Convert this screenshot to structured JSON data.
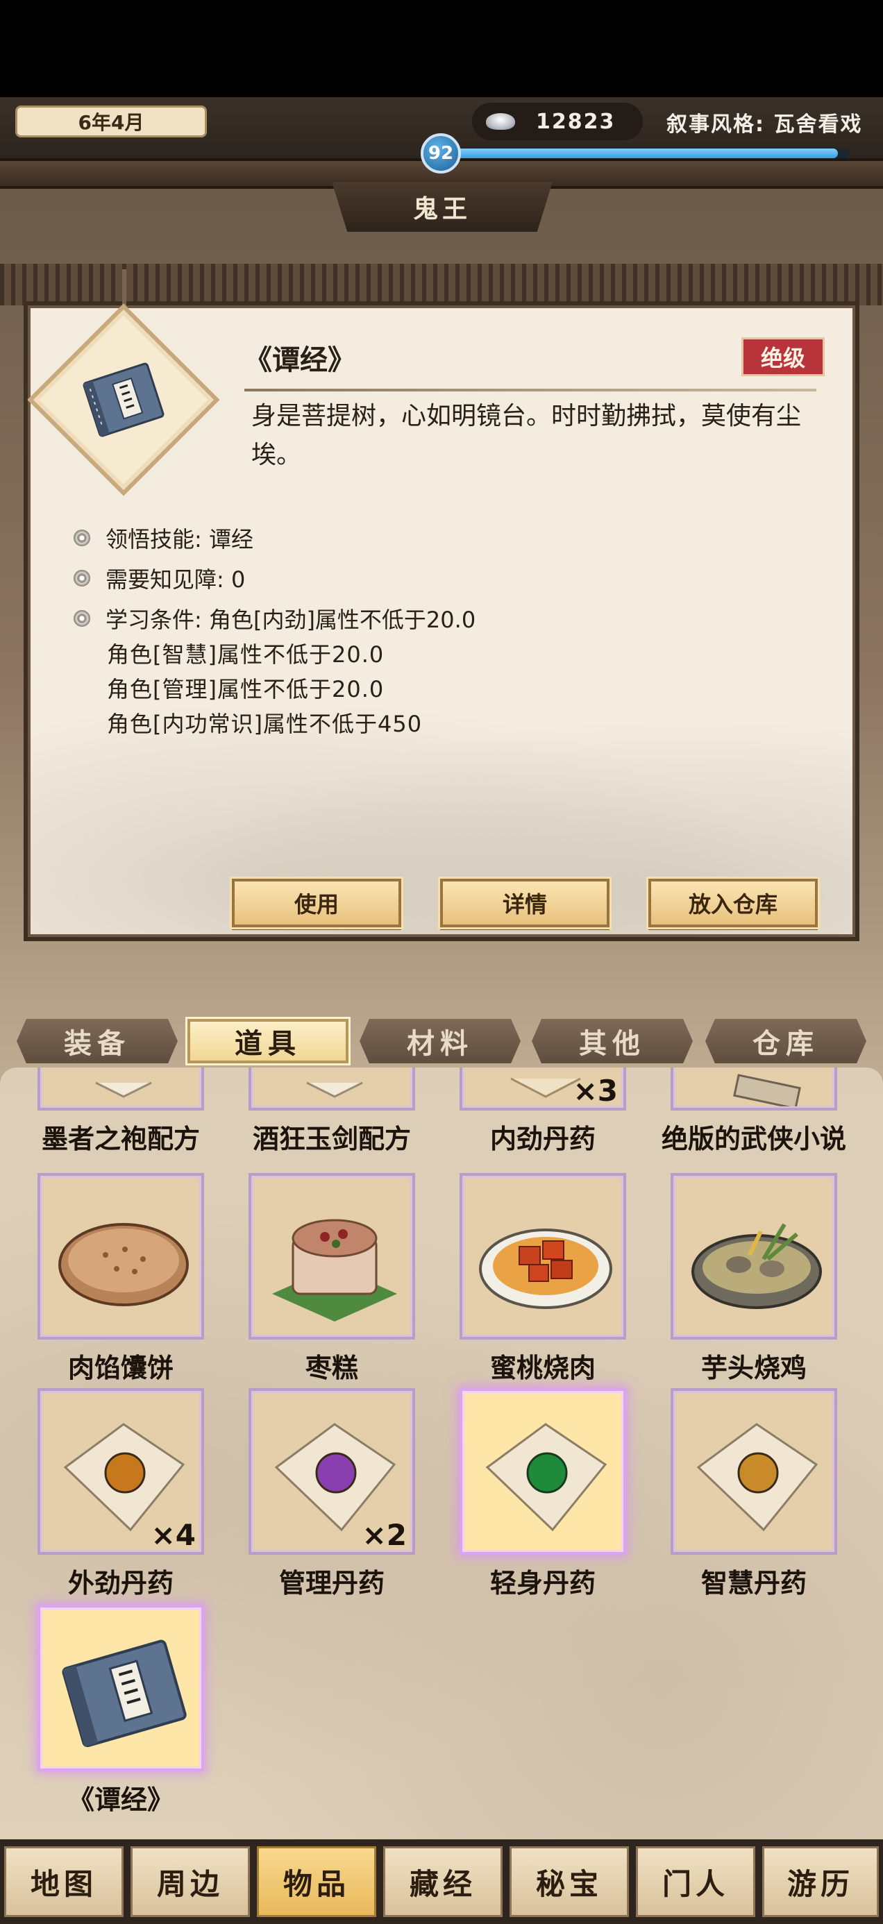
{
  "header": {
    "date": "6年4月",
    "silver": "12823",
    "style_label": "叙事风格: 瓦舍看戏",
    "level": "92",
    "xp_fraction": 0.97
  },
  "page_title": "鬼王",
  "item": {
    "name": "《谭经》",
    "grade": "绝级",
    "desc": "身是菩提树，心如明镜台。时时勤拂拭，莫使有尘埃。",
    "attrs": [
      "领悟技能: 谭经",
      "需要知见障: 0",
      "学习条件: 角色[内劲]属性不低于20.0"
    ],
    "conditions": [
      "角色[智慧]属性不低于20.0",
      "角色[管理]属性不低于20.0",
      "角色[内功常识]属性不低于450"
    ],
    "buttons": {
      "use": "使用",
      "detail": "详情",
      "store": "放入仓库"
    }
  },
  "tabs": [
    "装备",
    "道具",
    "材料",
    "其他",
    "仓库"
  ],
  "active_tab": "道具",
  "inventory": {
    "row0": [
      {
        "label": "墨者之袍配方"
      },
      {
        "label": "酒狂玉剑配方"
      },
      {
        "label": "内劲丹药",
        "qty": "×3"
      },
      {
        "label": "绝版的武侠小说"
      }
    ],
    "row1": [
      {
        "label": "肉馅馕饼"
      },
      {
        "label": "枣糕"
      },
      {
        "label": "蜜桃烧肉"
      },
      {
        "label": "芋头烧鸡"
      }
    ],
    "row2": [
      {
        "label": "外劲丹药",
        "qty": "×4",
        "pill_color": "#c8781c"
      },
      {
        "label": "管理丹药",
        "qty": "×2",
        "pill_color": "#8a3fb0"
      },
      {
        "label": "轻身丹药",
        "pill_color": "#1f8a3a"
      },
      {
        "label": "智慧丹药",
        "pill_color": "#c98a2a"
      }
    ],
    "row3": [
      {
        "label": "《谭经》"
      }
    ]
  },
  "nav": [
    "地图",
    "周边",
    "物品",
    "藏经",
    "秘宝",
    "门人",
    "游历"
  ],
  "active_nav": "物品"
}
